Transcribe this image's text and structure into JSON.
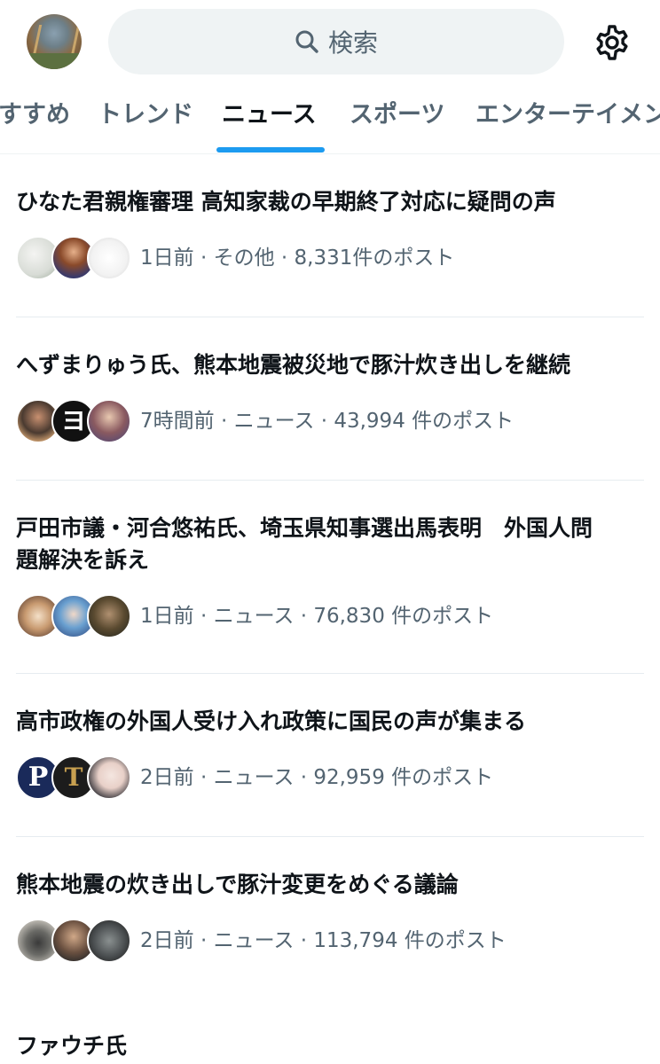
{
  "search": {
    "placeholder": "検索",
    "icon": "search-icon"
  },
  "settings_icon": "gear-icon",
  "tabs": [
    {
      "label": "すすめ",
      "active": false
    },
    {
      "label": "トレンド",
      "active": false
    },
    {
      "label": "ニュース",
      "active": true
    },
    {
      "label": "スポーツ",
      "active": false
    },
    {
      "label": "エンターテイメン",
      "active": false
    }
  ],
  "accent_color": "#1d9bf0",
  "items": [
    {
      "title": "ひなた君親権審理 高知家裁の早期終了対応に疑問の声",
      "meta": "1日前 · その他 · 8,331件のポスト"
    },
    {
      "title": "へずまりゅう氏、熊本地震被災地で豚汁炊き出しを継続",
      "meta": "7時間前 · ニュース · 43,994 件のポスト"
    },
    {
      "title": "戸田市議・河合悠祐氏、埼玉県知事選出馬表明　外国人問題解決を訴え",
      "title_line1": "戸田市議・河合悠祐氏、埼玉県知事選出馬表明　外国人問",
      "title_line2": "題解決を訴え",
      "meta": "1日前 · ニュース · 76,830 件のポスト"
    },
    {
      "title": "高市政権の外国人受け入れ政策に国民の声が集まる",
      "meta": "2日前 · ニュース · 92,959 件のポスト"
    },
    {
      "title": "熊本地震の炊き出しで豚汁変更をめぐる議論",
      "meta": "2日前 · ニュース · 113,794 件のポスト"
    },
    {
      "title": "ファウチ氏"
    }
  ],
  "face_labels": {
    "p_badge": "P",
    "t_badge": "T",
    "e_badge": "ヨ"
  }
}
